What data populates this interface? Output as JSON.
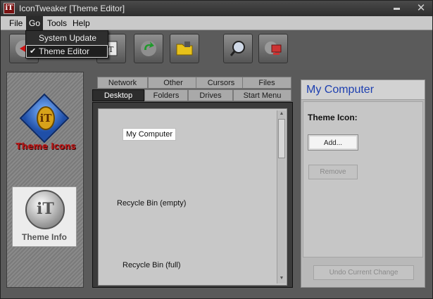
{
  "window": {
    "title": "IconTweaker [Theme Editor]",
    "app_icon": "iT"
  },
  "menubar": {
    "items": [
      "File",
      "Go",
      "Tools",
      "Help"
    ]
  },
  "go_menu": {
    "items": [
      {
        "label": "System Update",
        "checked": false
      },
      {
        "label": "Theme Editor",
        "checked": true
      }
    ]
  },
  "toolbar": {
    "buttons": [
      "back-arrow-icon",
      "theme-editor-icon",
      "refresh-icon",
      "folder-icon",
      "magnifier-icon",
      "computer-icon"
    ]
  },
  "sidebar": {
    "theme_icons_label": "Theme Icons",
    "theme_info_label": "Theme Info"
  },
  "tabs": {
    "row1": [
      "Network",
      "Other",
      "Cursors",
      "Files"
    ],
    "row2": [
      "Desktop",
      "Folders",
      "Drives",
      "Start Menu"
    ],
    "active": "Desktop"
  },
  "icon_list": {
    "items": [
      "My Computer",
      "Recycle Bin (empty)",
      "Recycle Bin (full)"
    ],
    "selected": "My Computer"
  },
  "detail": {
    "title": "My Computer",
    "theme_icon_label": "Theme Icon:",
    "add_button": "Add...",
    "remove_button": "Remove",
    "undo_button": "Undo Current Change"
  },
  "colors": {
    "accent": "#1d3fb0",
    "brand_red": "#b81a1a",
    "menu_dark": "#2b2b2b"
  }
}
